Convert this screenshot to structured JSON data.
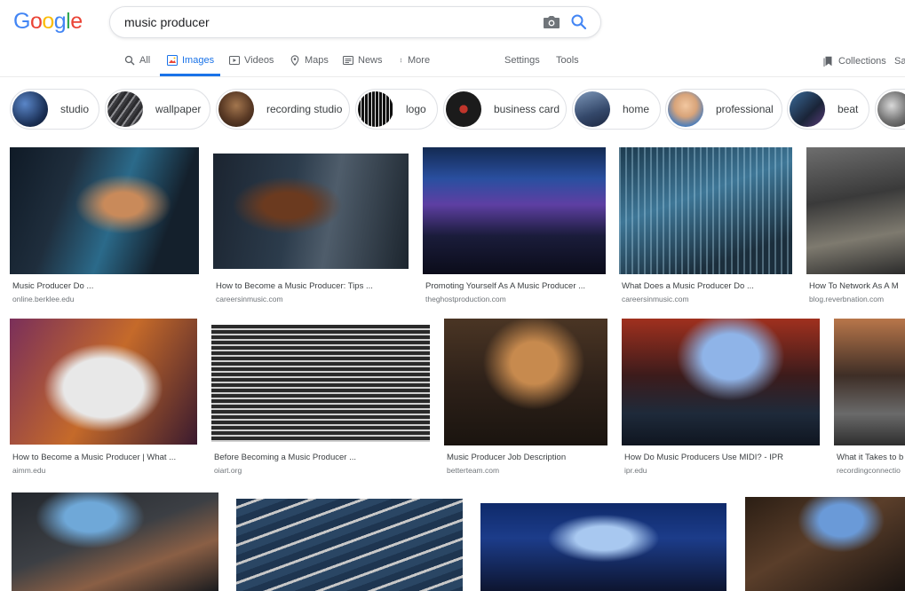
{
  "logo": {
    "letters": [
      "G",
      "o",
      "o",
      "g",
      "l",
      "e"
    ],
    "colors": [
      "#4285F4",
      "#EA4335",
      "#FBBC05",
      "#4285F4",
      "#34A853",
      "#EA4335"
    ]
  },
  "search": {
    "value": "music producer"
  },
  "nav": {
    "all": "All",
    "images": "Images",
    "videos": "Videos",
    "maps": "Maps",
    "news": "News",
    "more": "More",
    "settings": "Settings",
    "tools": "Tools",
    "collections": "Collections",
    "saf": "Sa"
  },
  "chips": [
    "studio",
    "wallpaper",
    "recording studio",
    "logo",
    "business card",
    "home",
    "professional",
    "beat"
  ],
  "results": [
    {
      "title": "Music Producer Do ...",
      "source": "online.berklee.edu"
    },
    {
      "title": "How to Become a Music Producer: Tips ...",
      "source": "careersinmusic.com"
    },
    {
      "title": "Promoting Yourself As A Music Producer ...",
      "source": "theghostproduction.com"
    },
    {
      "title": "What Does a Music Producer Do ...",
      "source": "careersinmusic.com"
    },
    {
      "title": "How To Network As A M",
      "source": "blog.reverbnation.com"
    },
    {
      "title": "How to Become a Music Producer | What ...",
      "source": "aimm.edu"
    },
    {
      "title": "Before Becoming a Music Producer ...",
      "source": "oiart.org"
    },
    {
      "title": "Music Producer Job Description",
      "source": "betterteam.com"
    },
    {
      "title": "How Do Music Producers Use MIDI? - IPR",
      "source": "ipr.edu"
    },
    {
      "title": "What it Takes to b",
      "source": "recordingconnectio"
    },
    {
      "title": "",
      "source": ""
    },
    {
      "title": "",
      "source": ""
    },
    {
      "title": "",
      "source": ""
    },
    {
      "title": "",
      "source": ""
    }
  ],
  "colors": {
    "accent": "#1a73e8",
    "text_secondary": "#5f6368"
  }
}
